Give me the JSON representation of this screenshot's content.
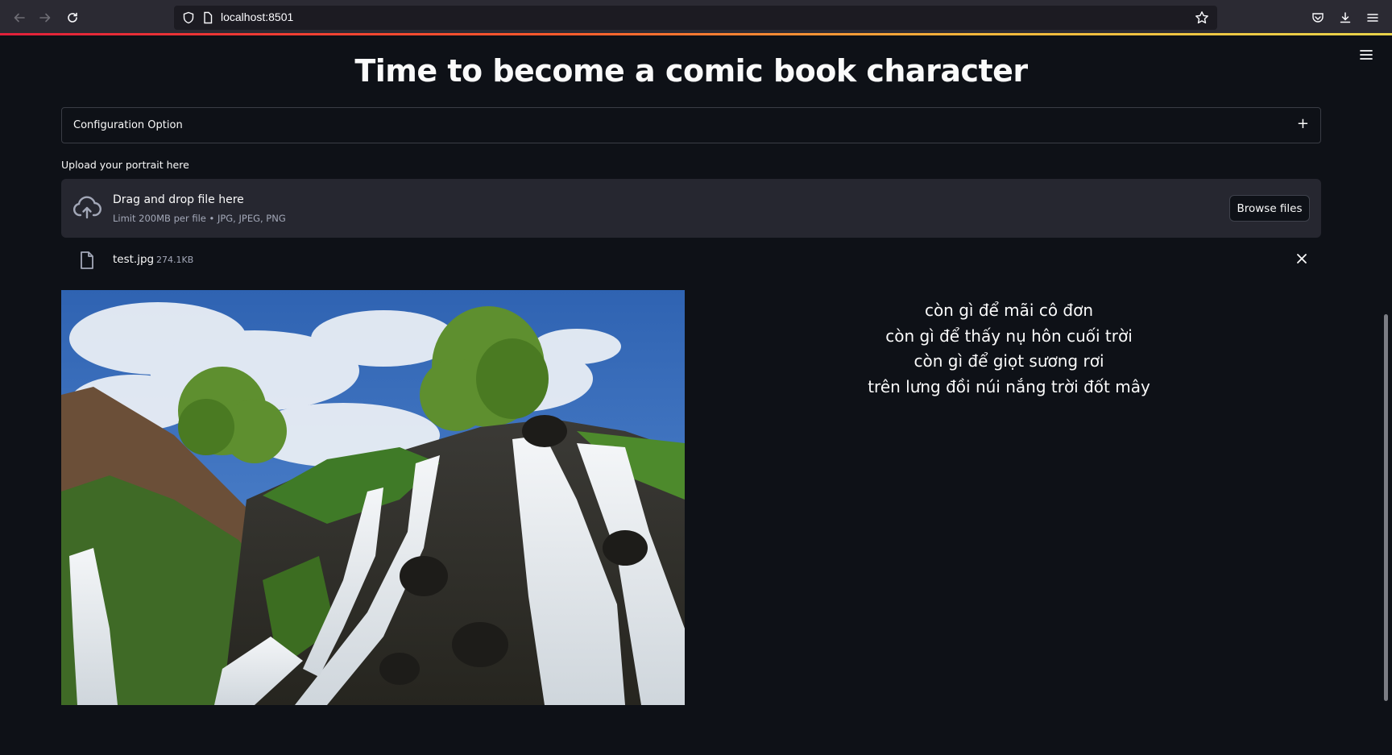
{
  "browser": {
    "url": "localhost:8501"
  },
  "app": {
    "title": "Time to become a comic book character",
    "expander_label": "Configuration Option",
    "expander_toggle": "+",
    "upload_label": "Upload your portrait here",
    "dropzone": {
      "title": "Drag and drop file here",
      "limit": "Limit 200MB per file • JPG, JPEG, PNG",
      "browse_label": "Browse files"
    },
    "uploaded_file": {
      "name": "test.jpg",
      "size": "274.1KB"
    },
    "poem": [
      "còn gì để mãi cô đơn",
      "còn gì để thấy nụ hôn cuối trời",
      "còn gì để giọt sương rơi",
      "trên lưng đồi núi nắng trời đốt mây"
    ]
  },
  "icons": {
    "back": "arrow-left-icon",
    "forward": "arrow-right-icon",
    "reload": "reload-icon",
    "shield": "shield-icon",
    "page": "page-icon",
    "bookmark": "star-icon",
    "pocket": "pocket-icon",
    "downloads": "download-icon",
    "app_menu": "hamburger-icon",
    "upload": "cloud-upload-icon",
    "file": "file-icon",
    "remove": "close-icon"
  },
  "colors": {
    "background": "#0e1117",
    "dropzone": "#262730",
    "text": "#fafafa",
    "muted_text": "#a3a8b8"
  }
}
